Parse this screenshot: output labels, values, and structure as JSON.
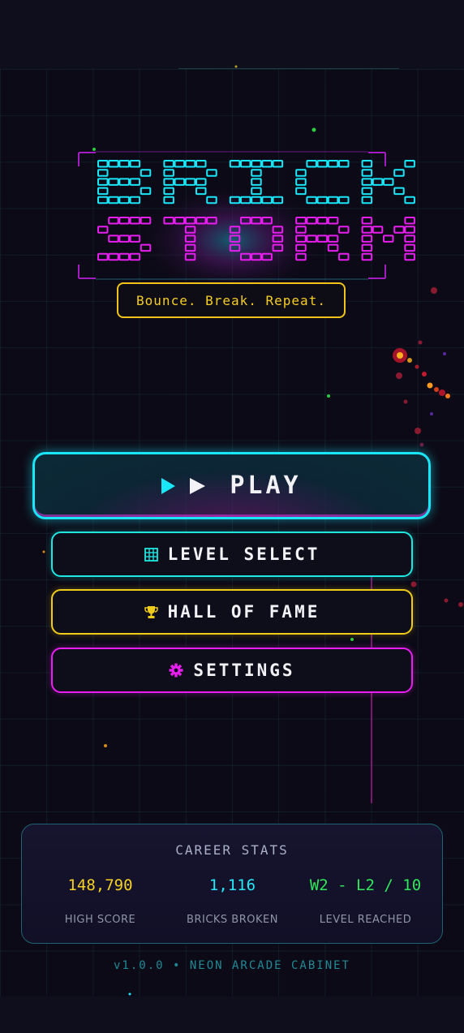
{
  "title": {
    "line1": "BRICK",
    "line2": "STORM"
  },
  "tagline": "Bounce. Break. Repeat.",
  "menu": {
    "play_label": "PLAY",
    "level_select_label": "LEVEL SELECT",
    "hall_of_fame_label": "HALL OF FAME",
    "settings_label": "SETTINGS"
  },
  "icons": {
    "play": "play-arrows-icon",
    "level_select": "grid-icon",
    "hall_of_fame": "trophy-icon",
    "settings": "gear-icon"
  },
  "career_stats": {
    "title": "CAREER STATS",
    "items": [
      {
        "value": "148,790",
        "label": "HIGH SCORE",
        "color": "#f6d024"
      },
      {
        "value": "1,116",
        "label": "BRICKS BROKEN",
        "color": "#27e8f8"
      },
      {
        "value": "W2 - L2 / 10",
        "label": "LEVEL REACHED",
        "color": "#2ee85a"
      }
    ]
  },
  "footer": "v1.0.0 • NEON ARCADE CABINET",
  "colors": {
    "cyan": "#19e6f8",
    "magenta": "#e81ef0",
    "yellow": "#f0cc1a",
    "green": "#2ee85a",
    "background": "#0c0a16"
  }
}
